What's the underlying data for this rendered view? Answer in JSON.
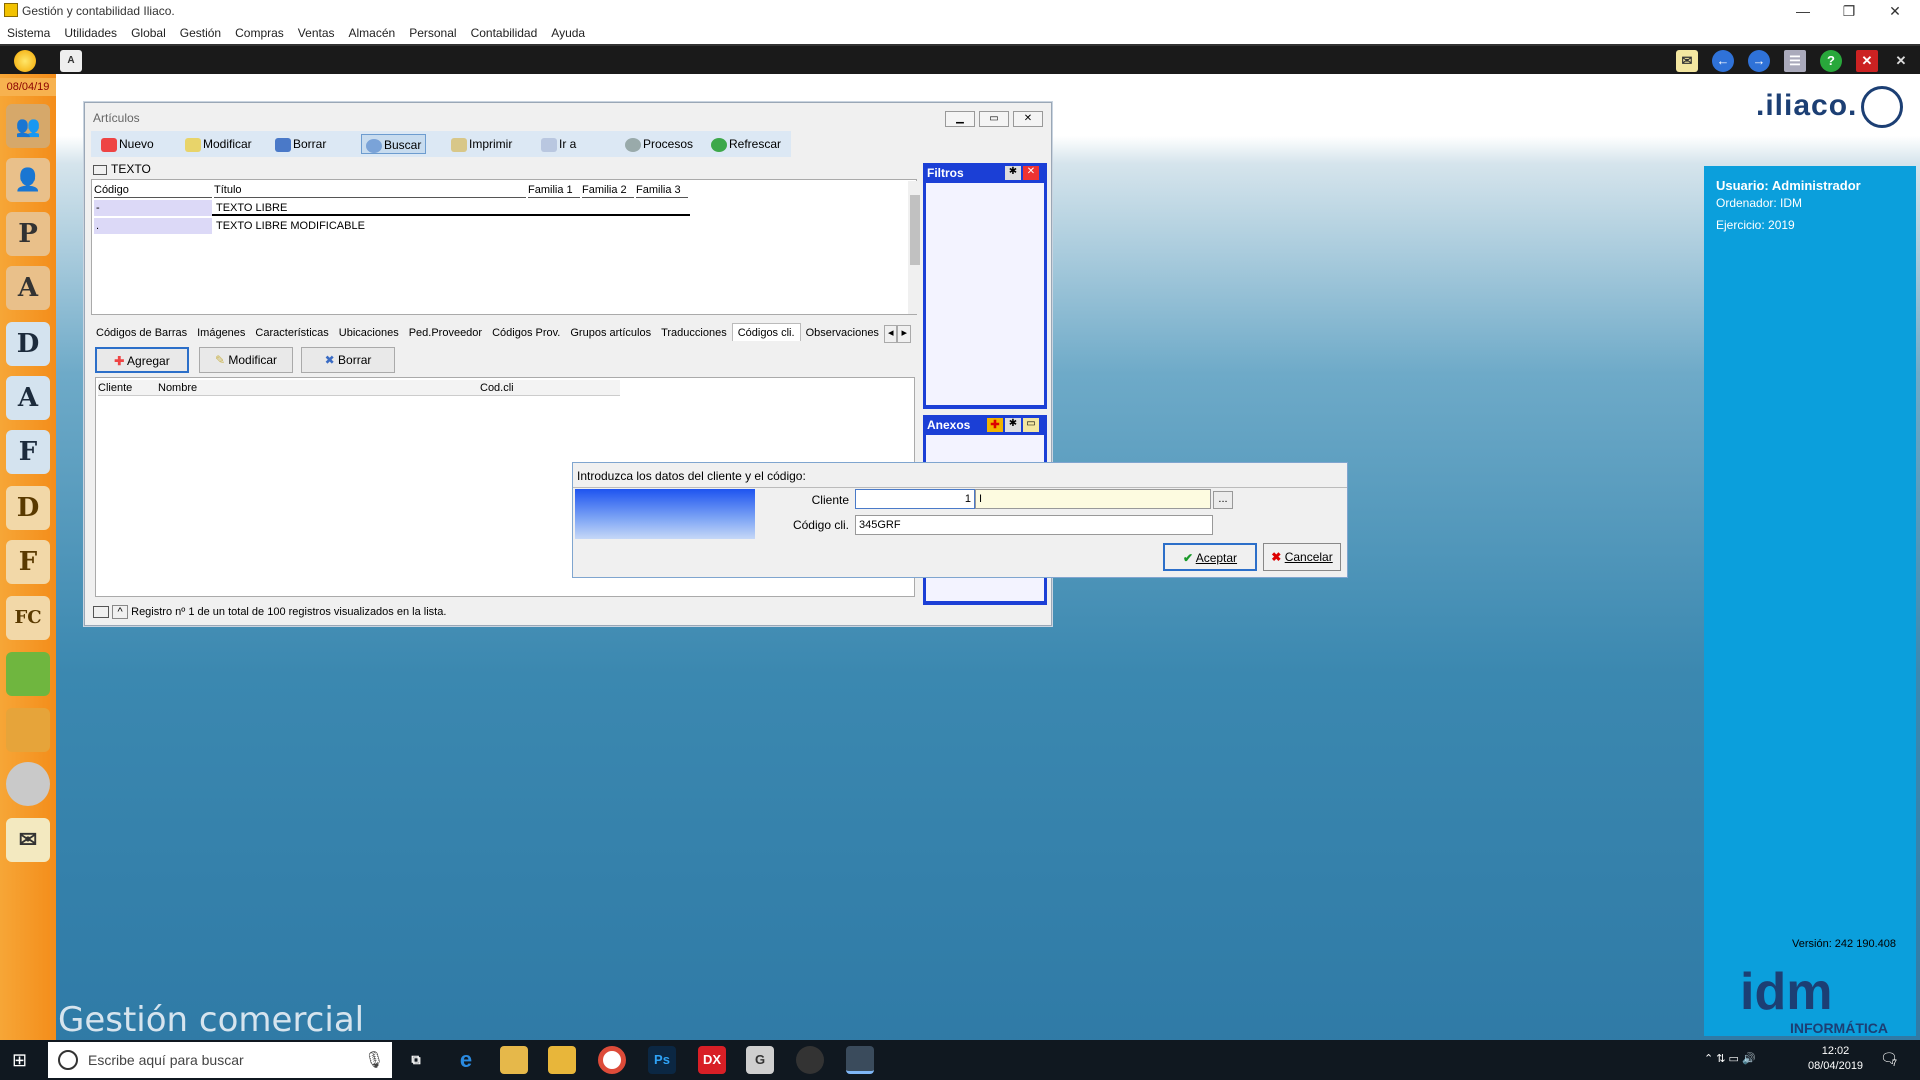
{
  "app": {
    "title": "Gestión y contabilidad Iliaco."
  },
  "menu": [
    "Sistema",
    "Utilidades",
    "Global",
    "Gestión",
    "Compras",
    "Ventas",
    "Almacén",
    "Personal",
    "Contabilidad",
    "Ayuda"
  ],
  "date_badge": "08/04/19",
  "sidebar_icons": [
    "clients-icon",
    "user-icon",
    "user-p-icon",
    "user-a-icon",
    "d-icon",
    "a-icon",
    "f-icon",
    "d2-icon",
    "f2-icon",
    "fc-icon",
    "box-green-icon",
    "box-yellow-icon",
    "cd-icon",
    "mail-icon"
  ],
  "sidebar_letters": [
    "",
    "",
    "P",
    "A",
    "D",
    "A",
    "F",
    "D",
    "F",
    "FC",
    "",
    "",
    "",
    ""
  ],
  "articulos": {
    "title": "Artículos",
    "toolbar": [
      "Nuevo",
      "Modificar",
      "Borrar",
      "Buscar",
      "Imprimir",
      "Ir a",
      "Procesos",
      "Refrescar"
    ],
    "search_label": "TEXTO",
    "columns": [
      "Código",
      "Título",
      "Familia 1",
      "Familia 2",
      "Familia 3"
    ],
    "rows": [
      {
        "code": "-",
        "title": "TEXTO LIBRE"
      },
      {
        "code": ".",
        "title": "TEXTO LIBRE MODIFICABLE"
      }
    ],
    "tabs": [
      "Códigos de Barras",
      "Imágenes",
      "Características",
      "Ubicaciones",
      "Ped.Proveedor",
      "Códigos Prov.",
      "Grupos artículos",
      "Traducciones",
      "Códigos cli.",
      "Observaciones"
    ],
    "selected_tab": "Códigos cli.",
    "sub_toolbar": [
      "Agregar",
      "Modificar",
      "Borrar"
    ],
    "sub_columns": [
      "Cliente",
      "Nombre",
      "Cod.cli"
    ],
    "status": "Registro nº 1 de un total de 100 registros visualizados en la lista.",
    "filtros": "Filtros",
    "anexos": "Anexos"
  },
  "dialog": {
    "prompt": "Introduzca los datos del cliente y el código:",
    "cliente_label": "Cliente",
    "cliente_value": "1",
    "cliente_name": "I",
    "codigo_label": "Código cli.",
    "codigo_value": "345GRF",
    "ok": "Aceptar",
    "cancel": "Cancelar",
    "browse": "..."
  },
  "right_panel": {
    "usuario": "Usuario: Administrador",
    "ordenador": "Ordenador: IDM",
    "ejercicio": "Ejercicio: 2019",
    "version": "Versión: 242 190.408"
  },
  "brand": {
    "logo": ".iliaco.",
    "footer": "Gestión comercial",
    "idm": "idm",
    "idm_sub": "INFORMÁTICA"
  },
  "taskbar": {
    "search_placeholder": "Escribe aquí para buscar",
    "time": "12:02",
    "date": "08/04/2019",
    "notifications": "7"
  },
  "colors": {
    "accent_orange": "#f48d1a",
    "panel_blue": "#0b9fdc",
    "filter_blue": "#1b3fd6"
  }
}
